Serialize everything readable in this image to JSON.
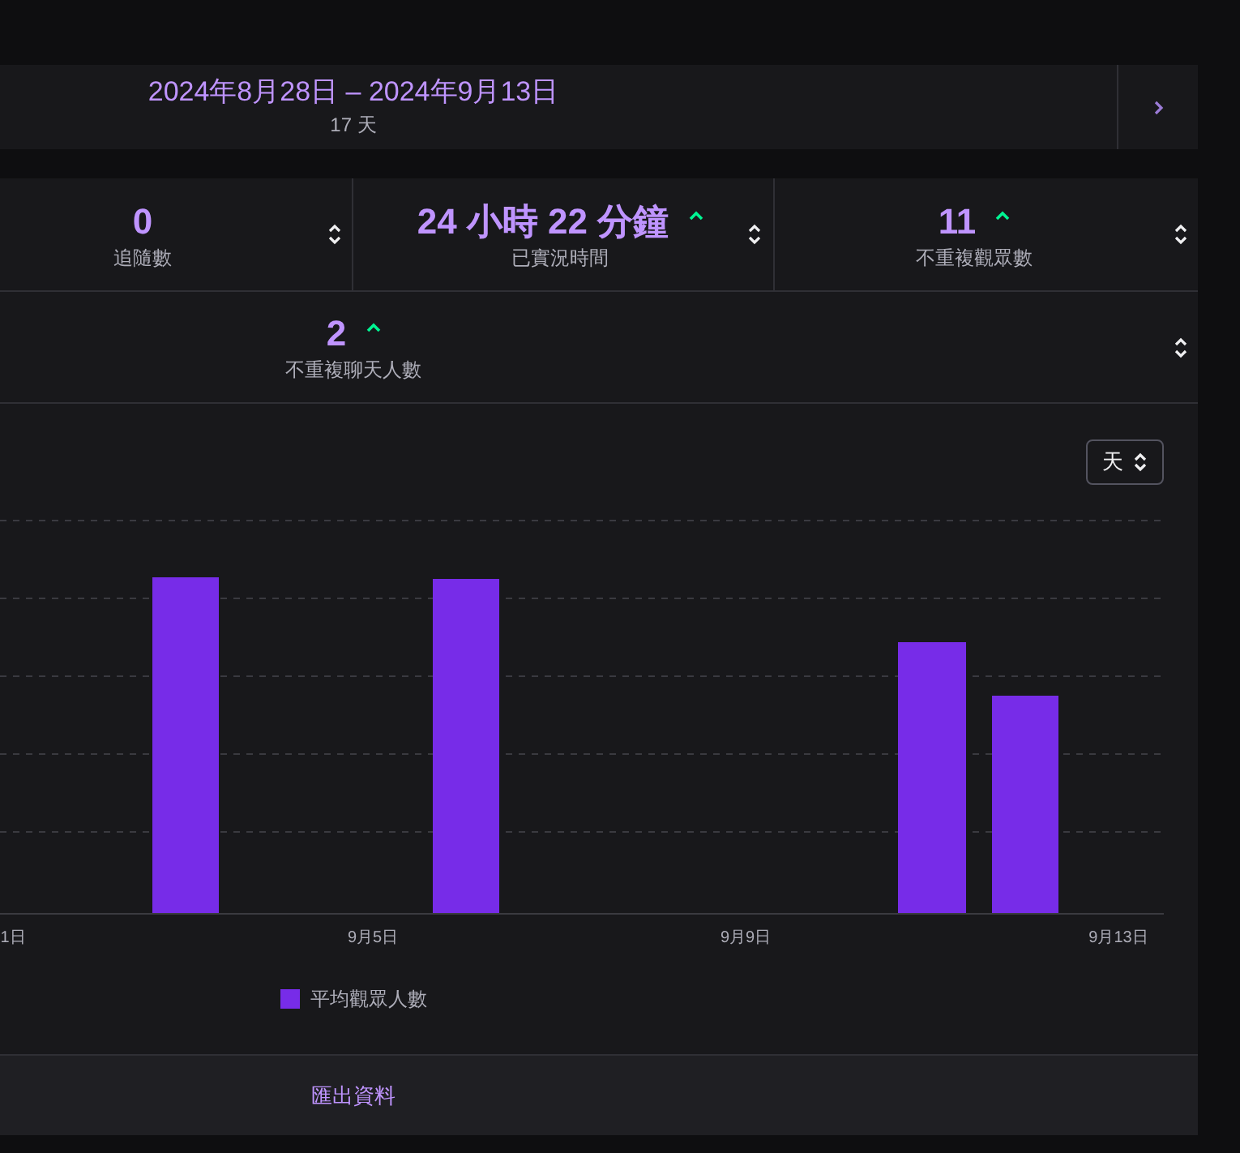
{
  "date_range": {
    "label": "2024年8月28日 – 2024年9月13日",
    "days": "17 天"
  },
  "stats": [
    {
      "value": "0",
      "label": "追隨數",
      "trending_up": false
    },
    {
      "value": "24 小時 22 分鐘",
      "label": "已實況時間",
      "trending_up": true
    },
    {
      "value": "11",
      "label": "不重複觀眾數",
      "trending_up": true
    },
    {
      "value": "2",
      "label": "不重複聊天人數",
      "trending_up": true
    }
  ],
  "chart": {
    "interval": "天",
    "x_labels": [
      "1日",
      "9月5日",
      "9月9日",
      "9月13日"
    ],
    "legend": [
      {
        "label": "平均觀眾人數",
        "color": "#772ce8"
      }
    ]
  },
  "export_link": "匯出資料"
}
